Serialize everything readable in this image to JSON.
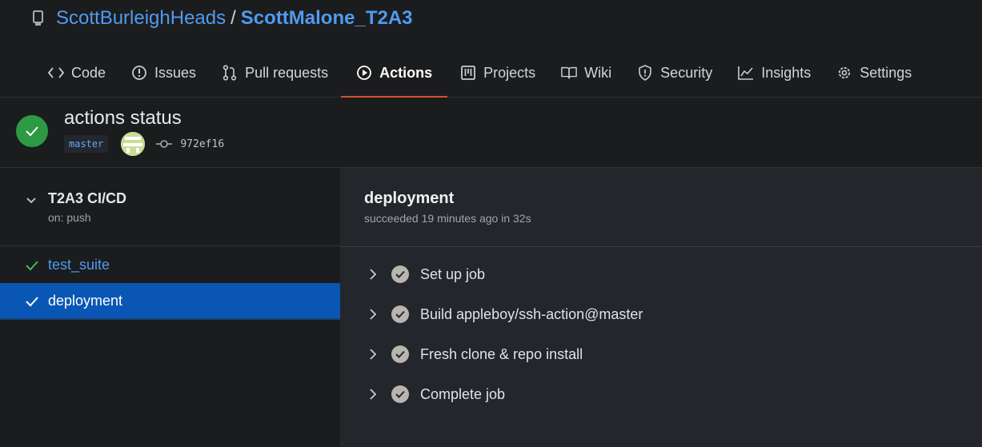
{
  "repo": {
    "owner": "ScottBurleighHeads",
    "separator": "/",
    "name": "ScottMalone_T2A3"
  },
  "tabs": [
    {
      "label": "Code",
      "icon": "code-icon"
    },
    {
      "label": "Issues",
      "icon": "issue-icon"
    },
    {
      "label": "Pull requests",
      "icon": "pull-request-icon"
    },
    {
      "label": "Actions",
      "icon": "play-icon",
      "active": true
    },
    {
      "label": "Projects",
      "icon": "project-icon"
    },
    {
      "label": "Wiki",
      "icon": "book-icon"
    },
    {
      "label": "Security",
      "icon": "shield-icon"
    },
    {
      "label": "Insights",
      "icon": "graph-icon"
    },
    {
      "label": "Settings",
      "icon": "gear-icon"
    }
  ],
  "run": {
    "title": "actions status",
    "branch": "master",
    "commit": "972ef16",
    "status_color": "#2c9a45"
  },
  "workflow": {
    "name": "T2A3 CI/CD",
    "trigger": "on: push",
    "jobs": [
      {
        "label": "test_suite",
        "status": "success"
      },
      {
        "label": "deployment",
        "status": "success",
        "selected": true
      }
    ]
  },
  "job": {
    "title": "deployment",
    "summary": "succeeded 19 minutes ago in 32s",
    "steps": [
      {
        "label": "Set up job"
      },
      {
        "label": "Build appleboy/ssh-action@master"
      },
      {
        "label": "Fresh clone & repo install"
      },
      {
        "label": "Complete job"
      }
    ]
  },
  "colors": {
    "link": "#4f9bf0",
    "accent_underline": "#d3512d",
    "selected_bg": "#0a56b4"
  }
}
